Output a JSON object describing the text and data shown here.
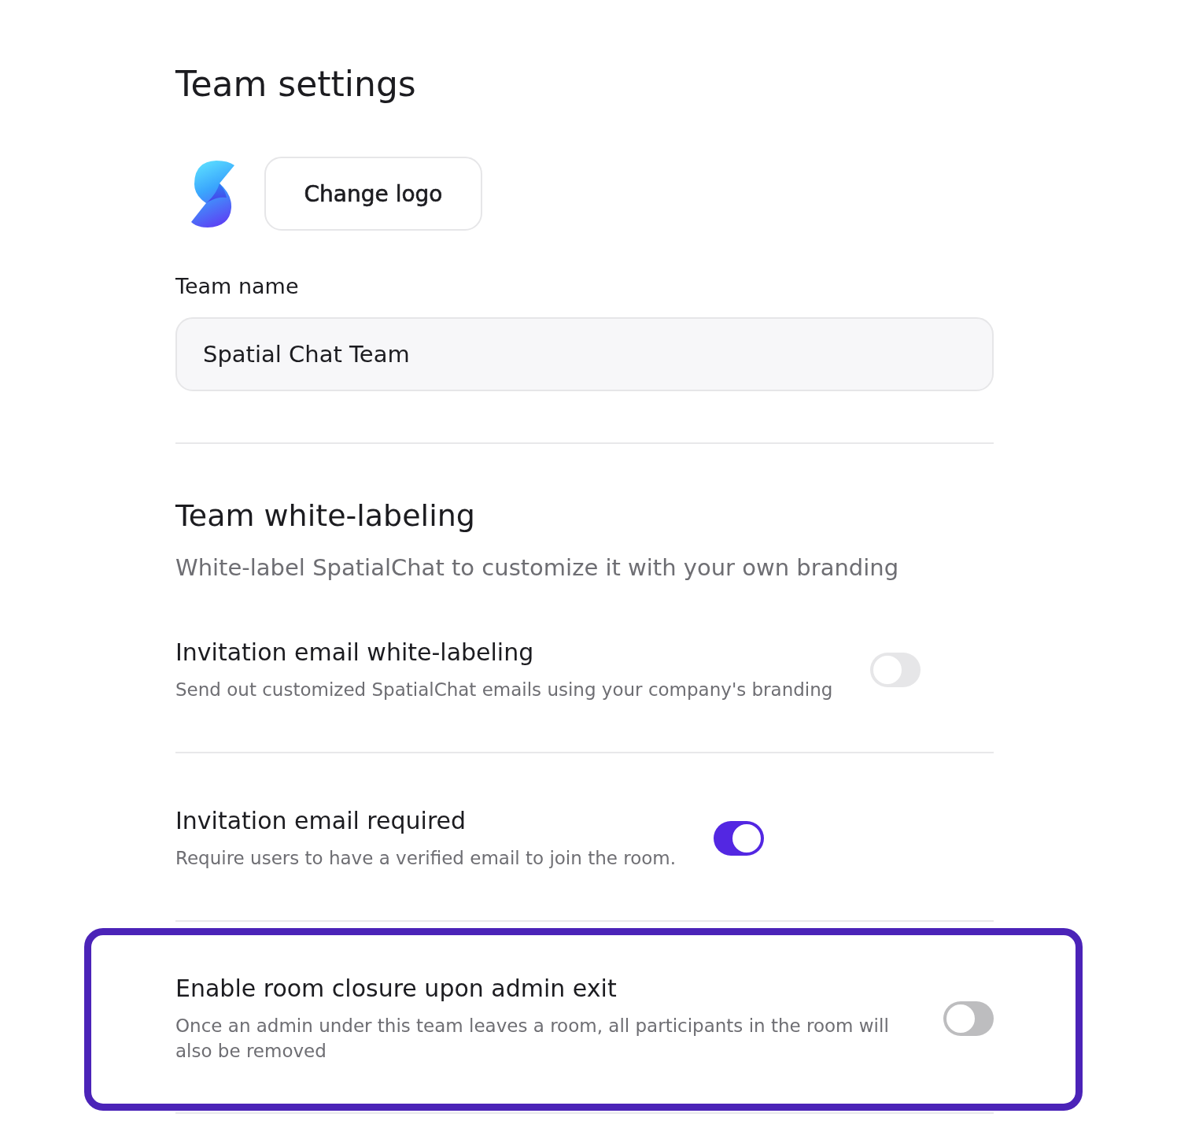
{
  "page": {
    "title": "Team settings"
  },
  "logo": {
    "button": "Change logo"
  },
  "team_name": {
    "label": "Team name",
    "value": "Spatial Chat Team"
  },
  "white_labeling": {
    "title": "Team white-labeling",
    "subtitle": "White-label SpatialChat to customize it with your own branding"
  },
  "settings": [
    {
      "title": "Invitation email white-labeling",
      "description": "Send out customized SpatialChat emails using your company's branding",
      "on": false,
      "disabled": true,
      "highlighted": false
    },
    {
      "title": "Invitation email required",
      "description": "Require users to have a verified email to join the room.",
      "on": true,
      "disabled": false,
      "highlighted": false
    },
    {
      "title": "Enable room closure upon admin exit",
      "description": "Once an admin under this team leaves a room, all participants in the room will also be removed",
      "on": false,
      "disabled": false,
      "highlighted": true
    }
  ]
}
